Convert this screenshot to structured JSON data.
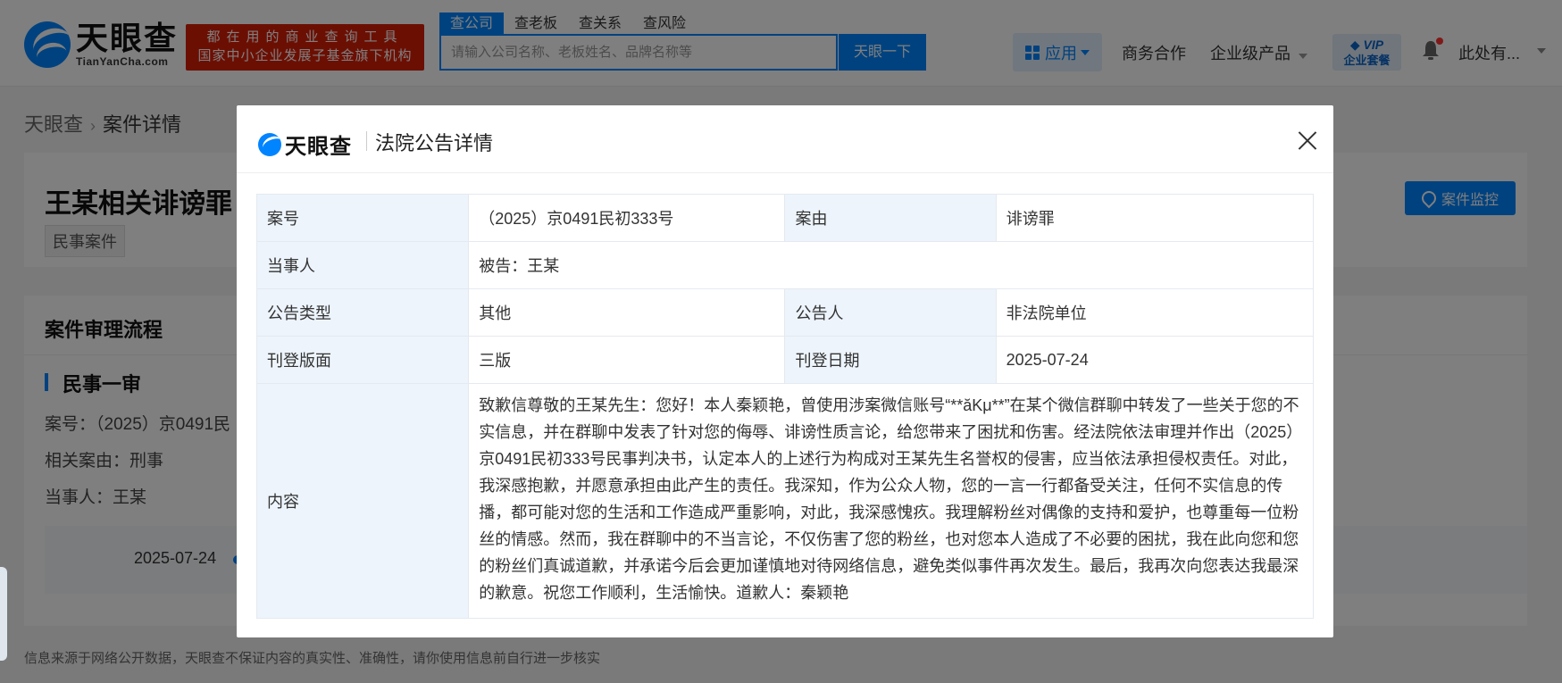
{
  "header": {
    "logo_cn": "天眼查",
    "logo_en": "TianYanCha.com",
    "slogan_line1": "都在用的商业查询工具",
    "slogan_line2": "国家中小企业发展子基金旗下机构",
    "search_tabs": [
      "查公司",
      "查老板",
      "查关系",
      "查风险"
    ],
    "search_placeholder": "请输入公司名称、老板姓名、品牌名称等",
    "search_button": "天眼一下",
    "nav_app": "应用",
    "nav_business": "商务合作",
    "nav_enterprise": "企业级产品",
    "vip_line1": "VIP",
    "vip_line2": "企业套餐",
    "user_name": "此处有..."
  },
  "breadcrumb": {
    "home": "天眼查",
    "current": "案件详情"
  },
  "case": {
    "title": "王某相关诽谤罪",
    "tag": "民事案件",
    "monitor_button": "案件监控"
  },
  "process": {
    "title": "案件审理流程",
    "stage": "民事一审",
    "case_no_line": "案号：（2025）京0491民",
    "cause_line": "相关案由：刑事",
    "party_line": "当事人：王某",
    "timeline_date": "2025-07-24"
  },
  "footer_note": "信息来源于网络公开数据，天眼查不保证内容的真实性、准确性，请你使用信息前自行进一步核实",
  "modal": {
    "logo": "天眼查",
    "title": "法院公告详情",
    "rows": {
      "case_no_label": "案号",
      "case_no_value": "（2025）京0491民初333号",
      "cause_label": "案由",
      "cause_value": "诽谤罪",
      "party_label": "当事人",
      "party_value": "被告：王某",
      "type_label": "公告类型",
      "type_value": "其他",
      "announcer_label": "公告人",
      "announcer_value": "非法院单位",
      "page_label": "刊登版面",
      "page_value": "三版",
      "date_label": "刊登日期",
      "date_value": "2025-07-24",
      "content_label": "内容",
      "content_value": "致歉信尊敬的王某先生：您好！本人秦颖艳，曾使用涉案微信账号“**ăKμ**”在某个微信群聊中转发了一些关于您的不实信息，并在群聊中发表了针对您的侮辱、诽谤性质言论，给您带来了困扰和伤害。经法院依法审理并作出（2025）京0491民初333号民事判决书，认定本人的上述行为构成对王某先生名誉权的侵害，应当依法承担侵权责任。对此，我深感抱歉，并愿意承担由此产生的责任。我深知，作为公众人物，您的一言一行都备受关注，任何不实信息的传播，都可能对您的生活和工作造成严重影响，对此，我深感愧疚。我理解粉丝对偶像的支持和爱护，也尊重每一位粉丝的情感。然而，我在群聊中的不当言论，不仅伤害了您的粉丝，也对您本人造成了不必要的困扰，我在此向您和您的粉丝们真诚道歉，并承诺今后会更加谨慎地对待网络信息，避免类似事件再次发生。最后，我再次向您表达我最深的歉意。祝您工作顺利，生活愉快。道歉人：秦颖艳"
    }
  },
  "colors": {
    "brand_blue": "#0084ff",
    "slogan_red": "#d81e06",
    "label_bg": "#edf4fc"
  }
}
